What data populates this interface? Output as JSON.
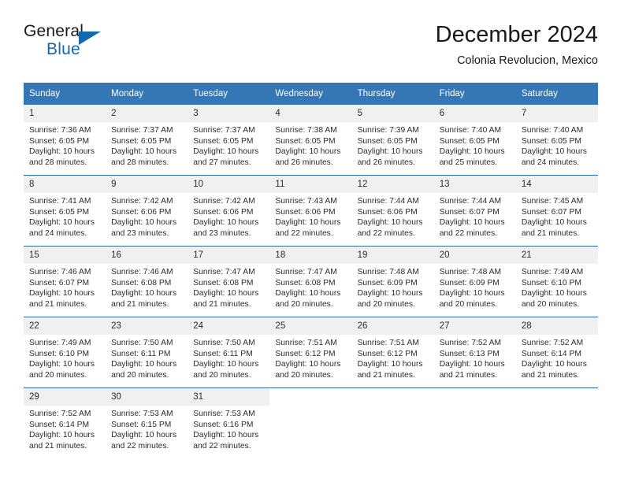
{
  "brand": {
    "word_one": "General",
    "word_two": "Blue",
    "triangle_icon": "blue-triangle-icon"
  },
  "header": {
    "title": "December 2024",
    "subtitle": "Colonia Revolucion, Mexico"
  },
  "colors": {
    "header_blue": "#3576b5",
    "brand_blue": "#1368b0",
    "daynum_band": "#f0f0f0",
    "row_divider": "#2a6aa8"
  },
  "calendar": {
    "weekday_headers": [
      "Sunday",
      "Monday",
      "Tuesday",
      "Wednesday",
      "Thursday",
      "Friday",
      "Saturday"
    ],
    "labels": {
      "sunrise": "Sunrise:",
      "sunset": "Sunset:",
      "daylight": "Daylight:"
    },
    "weeks": [
      [
        {
          "day": "1",
          "sunrise": "Sunrise: 7:36 AM",
          "sunset": "Sunset: 6:05 PM",
          "daylight_line1": "Daylight: 10 hours",
          "daylight_line2": "and 28 minutes."
        },
        {
          "day": "2",
          "sunrise": "Sunrise: 7:37 AM",
          "sunset": "Sunset: 6:05 PM",
          "daylight_line1": "Daylight: 10 hours",
          "daylight_line2": "and 28 minutes."
        },
        {
          "day": "3",
          "sunrise": "Sunrise: 7:37 AM",
          "sunset": "Sunset: 6:05 PM",
          "daylight_line1": "Daylight: 10 hours",
          "daylight_line2": "and 27 minutes."
        },
        {
          "day": "4",
          "sunrise": "Sunrise: 7:38 AM",
          "sunset": "Sunset: 6:05 PM",
          "daylight_line1": "Daylight: 10 hours",
          "daylight_line2": "and 26 minutes."
        },
        {
          "day": "5",
          "sunrise": "Sunrise: 7:39 AM",
          "sunset": "Sunset: 6:05 PM",
          "daylight_line1": "Daylight: 10 hours",
          "daylight_line2": "and 26 minutes."
        },
        {
          "day": "6",
          "sunrise": "Sunrise: 7:40 AM",
          "sunset": "Sunset: 6:05 PM",
          "daylight_line1": "Daylight: 10 hours",
          "daylight_line2": "and 25 minutes."
        },
        {
          "day": "7",
          "sunrise": "Sunrise: 7:40 AM",
          "sunset": "Sunset: 6:05 PM",
          "daylight_line1": "Daylight: 10 hours",
          "daylight_line2": "and 24 minutes."
        }
      ],
      [
        {
          "day": "8",
          "sunrise": "Sunrise: 7:41 AM",
          "sunset": "Sunset: 6:05 PM",
          "daylight_line1": "Daylight: 10 hours",
          "daylight_line2": "and 24 minutes."
        },
        {
          "day": "9",
          "sunrise": "Sunrise: 7:42 AM",
          "sunset": "Sunset: 6:06 PM",
          "daylight_line1": "Daylight: 10 hours",
          "daylight_line2": "and 23 minutes."
        },
        {
          "day": "10",
          "sunrise": "Sunrise: 7:42 AM",
          "sunset": "Sunset: 6:06 PM",
          "daylight_line1": "Daylight: 10 hours",
          "daylight_line2": "and 23 minutes."
        },
        {
          "day": "11",
          "sunrise": "Sunrise: 7:43 AM",
          "sunset": "Sunset: 6:06 PM",
          "daylight_line1": "Daylight: 10 hours",
          "daylight_line2": "and 22 minutes."
        },
        {
          "day": "12",
          "sunrise": "Sunrise: 7:44 AM",
          "sunset": "Sunset: 6:06 PM",
          "daylight_line1": "Daylight: 10 hours",
          "daylight_line2": "and 22 minutes."
        },
        {
          "day": "13",
          "sunrise": "Sunrise: 7:44 AM",
          "sunset": "Sunset: 6:07 PM",
          "daylight_line1": "Daylight: 10 hours",
          "daylight_line2": "and 22 minutes."
        },
        {
          "day": "14",
          "sunrise": "Sunrise: 7:45 AM",
          "sunset": "Sunset: 6:07 PM",
          "daylight_line1": "Daylight: 10 hours",
          "daylight_line2": "and 21 minutes."
        }
      ],
      [
        {
          "day": "15",
          "sunrise": "Sunrise: 7:46 AM",
          "sunset": "Sunset: 6:07 PM",
          "daylight_line1": "Daylight: 10 hours",
          "daylight_line2": "and 21 minutes."
        },
        {
          "day": "16",
          "sunrise": "Sunrise: 7:46 AM",
          "sunset": "Sunset: 6:08 PM",
          "daylight_line1": "Daylight: 10 hours",
          "daylight_line2": "and 21 minutes."
        },
        {
          "day": "17",
          "sunrise": "Sunrise: 7:47 AM",
          "sunset": "Sunset: 6:08 PM",
          "daylight_line1": "Daylight: 10 hours",
          "daylight_line2": "and 21 minutes."
        },
        {
          "day": "18",
          "sunrise": "Sunrise: 7:47 AM",
          "sunset": "Sunset: 6:08 PM",
          "daylight_line1": "Daylight: 10 hours",
          "daylight_line2": "and 20 minutes."
        },
        {
          "day": "19",
          "sunrise": "Sunrise: 7:48 AM",
          "sunset": "Sunset: 6:09 PM",
          "daylight_line1": "Daylight: 10 hours",
          "daylight_line2": "and 20 minutes."
        },
        {
          "day": "20",
          "sunrise": "Sunrise: 7:48 AM",
          "sunset": "Sunset: 6:09 PM",
          "daylight_line1": "Daylight: 10 hours",
          "daylight_line2": "and 20 minutes."
        },
        {
          "day": "21",
          "sunrise": "Sunrise: 7:49 AM",
          "sunset": "Sunset: 6:10 PM",
          "daylight_line1": "Daylight: 10 hours",
          "daylight_line2": "and 20 minutes."
        }
      ],
      [
        {
          "day": "22",
          "sunrise": "Sunrise: 7:49 AM",
          "sunset": "Sunset: 6:10 PM",
          "daylight_line1": "Daylight: 10 hours",
          "daylight_line2": "and 20 minutes."
        },
        {
          "day": "23",
          "sunrise": "Sunrise: 7:50 AM",
          "sunset": "Sunset: 6:11 PM",
          "daylight_line1": "Daylight: 10 hours",
          "daylight_line2": "and 20 minutes."
        },
        {
          "day": "24",
          "sunrise": "Sunrise: 7:50 AM",
          "sunset": "Sunset: 6:11 PM",
          "daylight_line1": "Daylight: 10 hours",
          "daylight_line2": "and 20 minutes."
        },
        {
          "day": "25",
          "sunrise": "Sunrise: 7:51 AM",
          "sunset": "Sunset: 6:12 PM",
          "daylight_line1": "Daylight: 10 hours",
          "daylight_line2": "and 20 minutes."
        },
        {
          "day": "26",
          "sunrise": "Sunrise: 7:51 AM",
          "sunset": "Sunset: 6:12 PM",
          "daylight_line1": "Daylight: 10 hours",
          "daylight_line2": "and 21 minutes."
        },
        {
          "day": "27",
          "sunrise": "Sunrise: 7:52 AM",
          "sunset": "Sunset: 6:13 PM",
          "daylight_line1": "Daylight: 10 hours",
          "daylight_line2": "and 21 minutes."
        },
        {
          "day": "28",
          "sunrise": "Sunrise: 7:52 AM",
          "sunset": "Sunset: 6:14 PM",
          "daylight_line1": "Daylight: 10 hours",
          "daylight_line2": "and 21 minutes."
        }
      ],
      [
        {
          "day": "29",
          "sunrise": "Sunrise: 7:52 AM",
          "sunset": "Sunset: 6:14 PM",
          "daylight_line1": "Daylight: 10 hours",
          "daylight_line2": "and 21 minutes."
        },
        {
          "day": "30",
          "sunrise": "Sunrise: 7:53 AM",
          "sunset": "Sunset: 6:15 PM",
          "daylight_line1": "Daylight: 10 hours",
          "daylight_line2": "and 22 minutes."
        },
        {
          "day": "31",
          "sunrise": "Sunrise: 7:53 AM",
          "sunset": "Sunset: 6:16 PM",
          "daylight_line1": "Daylight: 10 hours",
          "daylight_line2": "and 22 minutes."
        },
        {
          "day": "",
          "sunrise": "",
          "sunset": "",
          "daylight_line1": "",
          "daylight_line2": ""
        },
        {
          "day": "",
          "sunrise": "",
          "sunset": "",
          "daylight_line1": "",
          "daylight_line2": ""
        },
        {
          "day": "",
          "sunrise": "",
          "sunset": "",
          "daylight_line1": "",
          "daylight_line2": ""
        },
        {
          "day": "",
          "sunrise": "",
          "sunset": "",
          "daylight_line1": "",
          "daylight_line2": ""
        }
      ]
    ]
  }
}
